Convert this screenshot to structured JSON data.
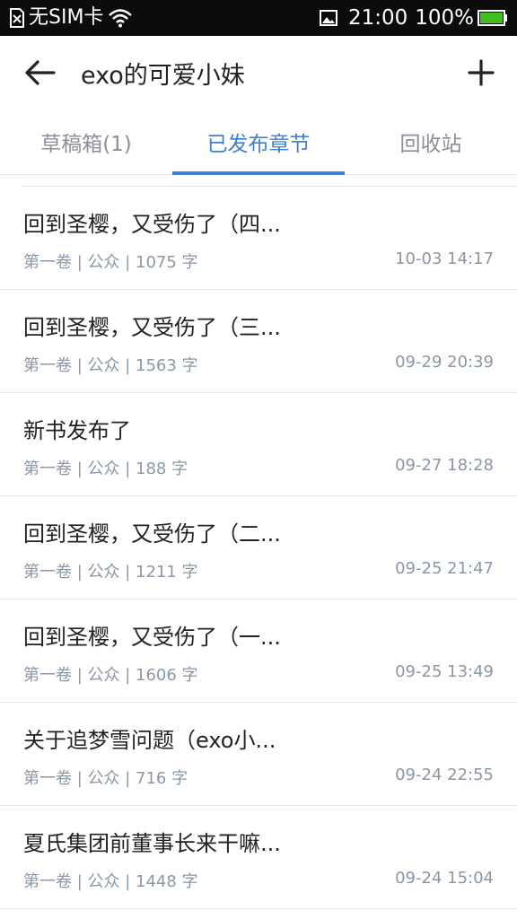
{
  "status_bar": {
    "carrier": "无SIM卡",
    "time": "21:00",
    "battery": "100%"
  },
  "app_bar": {
    "title": "exo的可爱小妹"
  },
  "tabs": [
    {
      "label": "草稿箱(1)",
      "active": false
    },
    {
      "label": "已发布章节",
      "active": true
    },
    {
      "label": "回收站",
      "active": false
    }
  ],
  "chapters": [
    {
      "title": "回到圣樱，又受伤了（四...",
      "meta": "第一卷 | 公众 | 1075 字",
      "time": "10-03 14:17"
    },
    {
      "title": "回到圣樱，又受伤了（三...",
      "meta": "第一卷 | 公众 | 1563 字",
      "time": "09-29 20:39"
    },
    {
      "title": "新书发布了",
      "meta": "第一卷 | 公众 | 188 字",
      "time": "09-27 18:28"
    },
    {
      "title": "回到圣樱，又受伤了（二...",
      "meta": "第一卷 | 公众 | 1211 字",
      "time": "09-25 21:47"
    },
    {
      "title": "回到圣樱，又受伤了（一...",
      "meta": "第一卷 | 公众 | 1606 字",
      "time": "09-25 13:49"
    },
    {
      "title": "关于追梦雪问题（exo小...",
      "meta": "第一卷 | 公众 | 716 字",
      "time": "09-24 22:55"
    },
    {
      "title": "夏氏集团前董事长来干嘛...",
      "meta": "第一卷 | 公众 | 1448 字",
      "time": "09-24 15:04"
    }
  ],
  "colors": {
    "accent": "#3c7fd3",
    "status_bar_bg": "#0c0c0c",
    "battery_green": "#3fbf1f"
  }
}
